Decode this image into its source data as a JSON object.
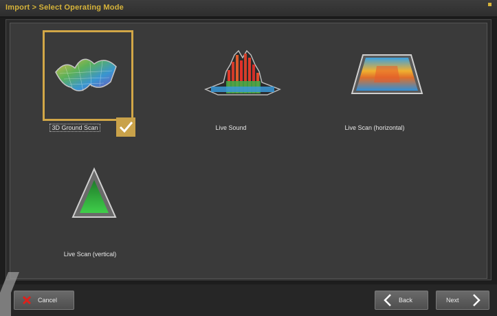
{
  "window": {
    "title": "Import > Select Operating Mode"
  },
  "modes": [
    {
      "label": "3D Ground Scan",
      "selected": true,
      "icon": "3d-ground-scan-icon"
    },
    {
      "label": "Live Sound",
      "selected": false,
      "icon": "live-sound-icon"
    },
    {
      "label": "Live Scan (horizontal)",
      "selected": false,
      "icon": "live-scan-horizontal-icon"
    },
    {
      "label": "Live Scan (vertical)",
      "selected": false,
      "icon": "live-scan-vertical-icon"
    }
  ],
  "footer": {
    "cancel_label": "Cancel",
    "back_label": "Back",
    "next_label": "Next"
  },
  "colors": {
    "accent": "#d2a747",
    "title_text": "#d7b43a",
    "cancel_icon": "#e0201a"
  }
}
